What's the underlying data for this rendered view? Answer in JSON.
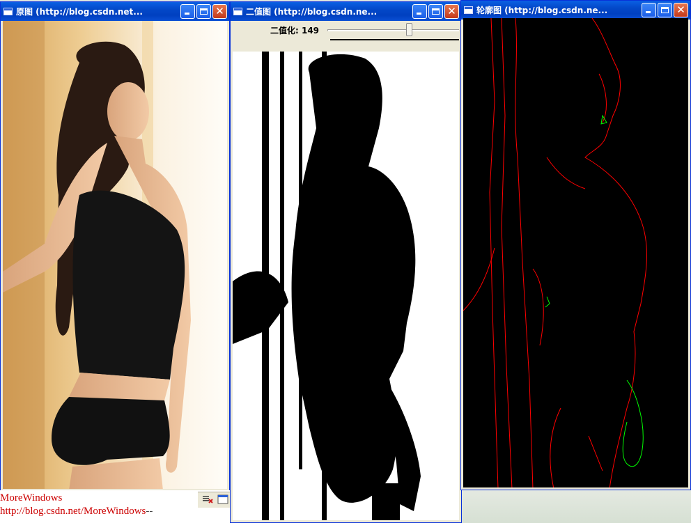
{
  "windows": {
    "original": {
      "title": "原图 (http://blog.csdn.net..."
    },
    "binary": {
      "title": "二值图 (http://blog.csdn.ne...",
      "trackbar_label": "二值化: 149",
      "trackbar_value": 149,
      "trackbar_max": 255
    },
    "contour": {
      "title": "轮廓图 (http://blog.csdn.ne..."
    }
  },
  "console": {
    "line1": "MoreWindows",
    "line2": "http://blog.csdn.net/MoreWindows",
    "line2_suffix": "--"
  },
  "colors": {
    "titlebar": "#0a5fe3",
    "contour_outer": "#ff0000",
    "contour_inner": "#00ff00",
    "console_text": "#cc0000"
  }
}
